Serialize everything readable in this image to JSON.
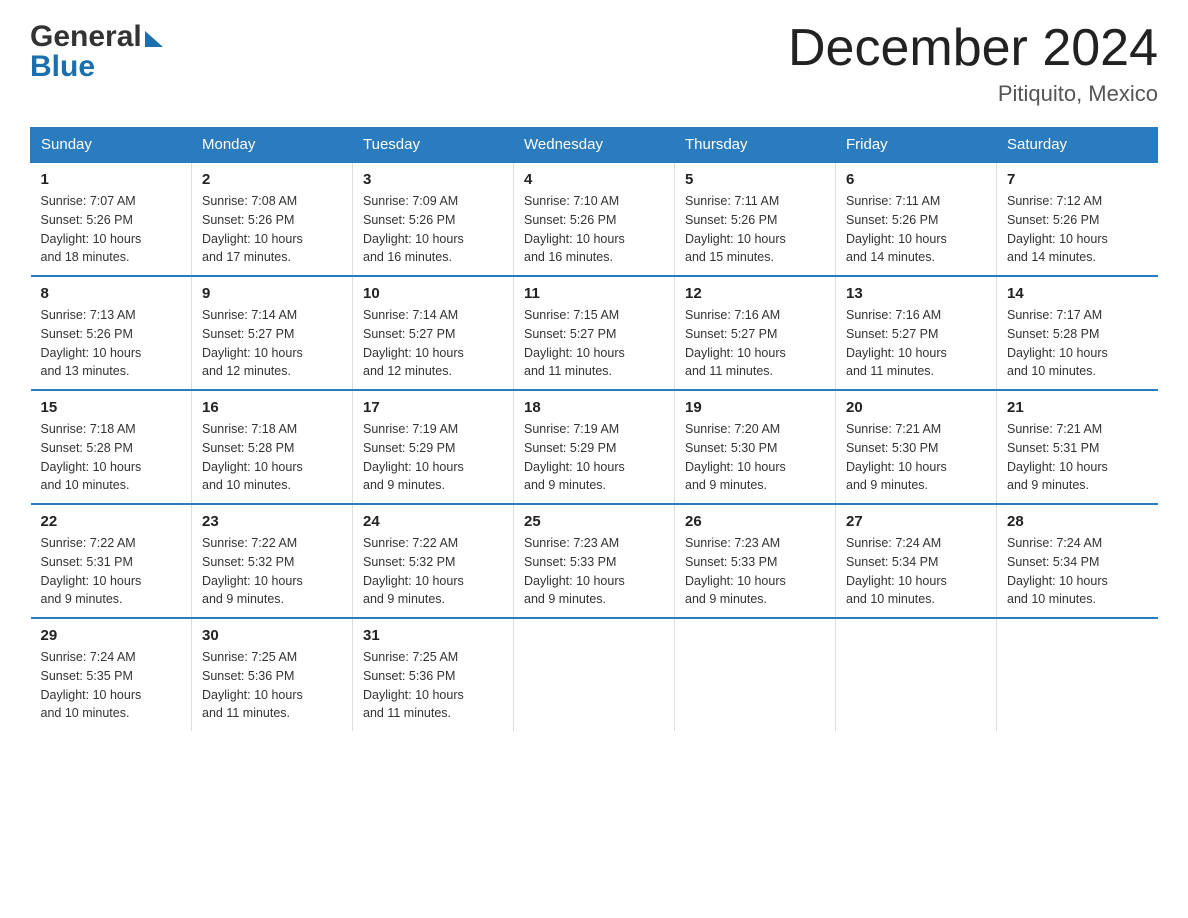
{
  "header": {
    "logo_general": "General",
    "logo_blue": "Blue",
    "month_title": "December 2024",
    "location": "Pitiquito, Mexico"
  },
  "days_of_week": [
    "Sunday",
    "Monday",
    "Tuesday",
    "Wednesday",
    "Thursday",
    "Friday",
    "Saturday"
  ],
  "weeks": [
    [
      {
        "day": "1",
        "sunrise": "7:07 AM",
        "sunset": "5:26 PM",
        "daylight": "10 hours and 18 minutes."
      },
      {
        "day": "2",
        "sunrise": "7:08 AM",
        "sunset": "5:26 PM",
        "daylight": "10 hours and 17 minutes."
      },
      {
        "day": "3",
        "sunrise": "7:09 AM",
        "sunset": "5:26 PM",
        "daylight": "10 hours and 16 minutes."
      },
      {
        "day": "4",
        "sunrise": "7:10 AM",
        "sunset": "5:26 PM",
        "daylight": "10 hours and 16 minutes."
      },
      {
        "day": "5",
        "sunrise": "7:11 AM",
        "sunset": "5:26 PM",
        "daylight": "10 hours and 15 minutes."
      },
      {
        "day": "6",
        "sunrise": "7:11 AM",
        "sunset": "5:26 PM",
        "daylight": "10 hours and 14 minutes."
      },
      {
        "day": "7",
        "sunrise": "7:12 AM",
        "sunset": "5:26 PM",
        "daylight": "10 hours and 14 minutes."
      }
    ],
    [
      {
        "day": "8",
        "sunrise": "7:13 AM",
        "sunset": "5:26 PM",
        "daylight": "10 hours and 13 minutes."
      },
      {
        "day": "9",
        "sunrise": "7:14 AM",
        "sunset": "5:27 PM",
        "daylight": "10 hours and 12 minutes."
      },
      {
        "day": "10",
        "sunrise": "7:14 AM",
        "sunset": "5:27 PM",
        "daylight": "10 hours and 12 minutes."
      },
      {
        "day": "11",
        "sunrise": "7:15 AM",
        "sunset": "5:27 PM",
        "daylight": "10 hours and 11 minutes."
      },
      {
        "day": "12",
        "sunrise": "7:16 AM",
        "sunset": "5:27 PM",
        "daylight": "10 hours and 11 minutes."
      },
      {
        "day": "13",
        "sunrise": "7:16 AM",
        "sunset": "5:27 PM",
        "daylight": "10 hours and 11 minutes."
      },
      {
        "day": "14",
        "sunrise": "7:17 AM",
        "sunset": "5:28 PM",
        "daylight": "10 hours and 10 minutes."
      }
    ],
    [
      {
        "day": "15",
        "sunrise": "7:18 AM",
        "sunset": "5:28 PM",
        "daylight": "10 hours and 10 minutes."
      },
      {
        "day": "16",
        "sunrise": "7:18 AM",
        "sunset": "5:28 PM",
        "daylight": "10 hours and 10 minutes."
      },
      {
        "day": "17",
        "sunrise": "7:19 AM",
        "sunset": "5:29 PM",
        "daylight": "10 hours and 9 minutes."
      },
      {
        "day": "18",
        "sunrise": "7:19 AM",
        "sunset": "5:29 PM",
        "daylight": "10 hours and 9 minutes."
      },
      {
        "day": "19",
        "sunrise": "7:20 AM",
        "sunset": "5:30 PM",
        "daylight": "10 hours and 9 minutes."
      },
      {
        "day": "20",
        "sunrise": "7:21 AM",
        "sunset": "5:30 PM",
        "daylight": "10 hours and 9 minutes."
      },
      {
        "day": "21",
        "sunrise": "7:21 AM",
        "sunset": "5:31 PM",
        "daylight": "10 hours and 9 minutes."
      }
    ],
    [
      {
        "day": "22",
        "sunrise": "7:22 AM",
        "sunset": "5:31 PM",
        "daylight": "10 hours and 9 minutes."
      },
      {
        "day": "23",
        "sunrise": "7:22 AM",
        "sunset": "5:32 PM",
        "daylight": "10 hours and 9 minutes."
      },
      {
        "day": "24",
        "sunrise": "7:22 AM",
        "sunset": "5:32 PM",
        "daylight": "10 hours and 9 minutes."
      },
      {
        "day": "25",
        "sunrise": "7:23 AM",
        "sunset": "5:33 PM",
        "daylight": "10 hours and 9 minutes."
      },
      {
        "day": "26",
        "sunrise": "7:23 AM",
        "sunset": "5:33 PM",
        "daylight": "10 hours and 9 minutes."
      },
      {
        "day": "27",
        "sunrise": "7:24 AM",
        "sunset": "5:34 PM",
        "daylight": "10 hours and 10 minutes."
      },
      {
        "day": "28",
        "sunrise": "7:24 AM",
        "sunset": "5:34 PM",
        "daylight": "10 hours and 10 minutes."
      }
    ],
    [
      {
        "day": "29",
        "sunrise": "7:24 AM",
        "sunset": "5:35 PM",
        "daylight": "10 hours and 10 minutes."
      },
      {
        "day": "30",
        "sunrise": "7:25 AM",
        "sunset": "5:36 PM",
        "daylight": "10 hours and 11 minutes."
      },
      {
        "day": "31",
        "sunrise": "7:25 AM",
        "sunset": "5:36 PM",
        "daylight": "10 hours and 11 minutes."
      },
      null,
      null,
      null,
      null
    ]
  ],
  "labels": {
    "sunrise": "Sunrise:",
    "sunset": "Sunset:",
    "daylight": "Daylight:"
  }
}
